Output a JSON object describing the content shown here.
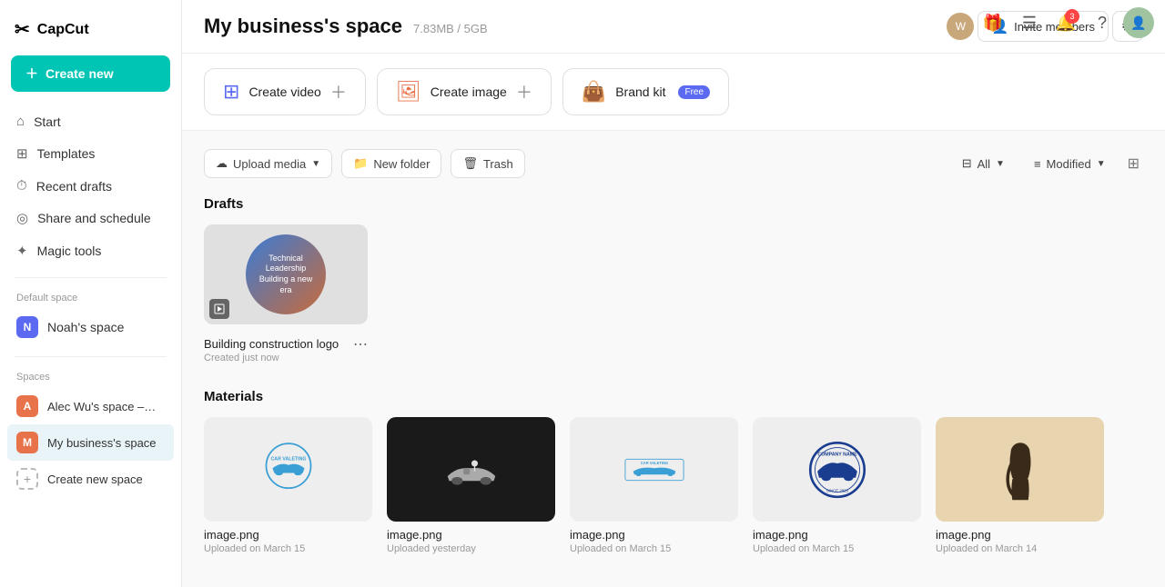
{
  "app": {
    "name": "CapCut"
  },
  "sidebar": {
    "logo": "CapCut",
    "create_new_label": "Create new",
    "nav_items": [
      {
        "id": "start",
        "label": "Start",
        "icon": "⌂"
      },
      {
        "id": "templates",
        "label": "Templates",
        "icon": "⊞"
      },
      {
        "id": "recent-drafts",
        "label": "Recent drafts",
        "icon": "⏱"
      },
      {
        "id": "share-schedule",
        "label": "Share and schedule",
        "icon": "◎"
      },
      {
        "id": "magic-tools",
        "label": "Magic tools",
        "icon": "✦"
      }
    ],
    "default_space_label": "Default space",
    "spaces_label": "Spaces",
    "noahs_space": "Noah's space",
    "alecs_space": "Alec Wu's space – w...",
    "my_business_space": "My business's space",
    "create_new_space": "Create new space"
  },
  "header": {
    "title": "My business's space",
    "storage": "7.83MB / 5GB",
    "invite_label": "Invite members",
    "notification_count": "3"
  },
  "toolbar": {
    "create_video": "Create video",
    "create_image": "Create image",
    "brand_kit": "Brand kit",
    "free_label": "Free"
  },
  "filter_bar": {
    "upload_media": "Upload media",
    "new_folder": "New folder",
    "trash": "Trash",
    "all_label": "All",
    "modified_label": "Modified"
  },
  "drafts": {
    "section_title": "Drafts",
    "items": [
      {
        "name": "Building construction logo",
        "date": "Created just now",
        "type": "image"
      }
    ]
  },
  "materials": {
    "section_title": "Materials",
    "items": [
      {
        "name": "image.png",
        "date": "Uploaded on March 15",
        "style": "light"
      },
      {
        "name": "image.png",
        "date": "Uploaded yesterday",
        "style": "dark"
      },
      {
        "name": "image.png",
        "date": "Uploaded on March 15",
        "style": "light"
      },
      {
        "name": "image.png",
        "date": "Uploaded on March 15",
        "style": "light"
      },
      {
        "name": "image.png",
        "date": "Uploaded on March 14",
        "style": "beige"
      }
    ]
  }
}
